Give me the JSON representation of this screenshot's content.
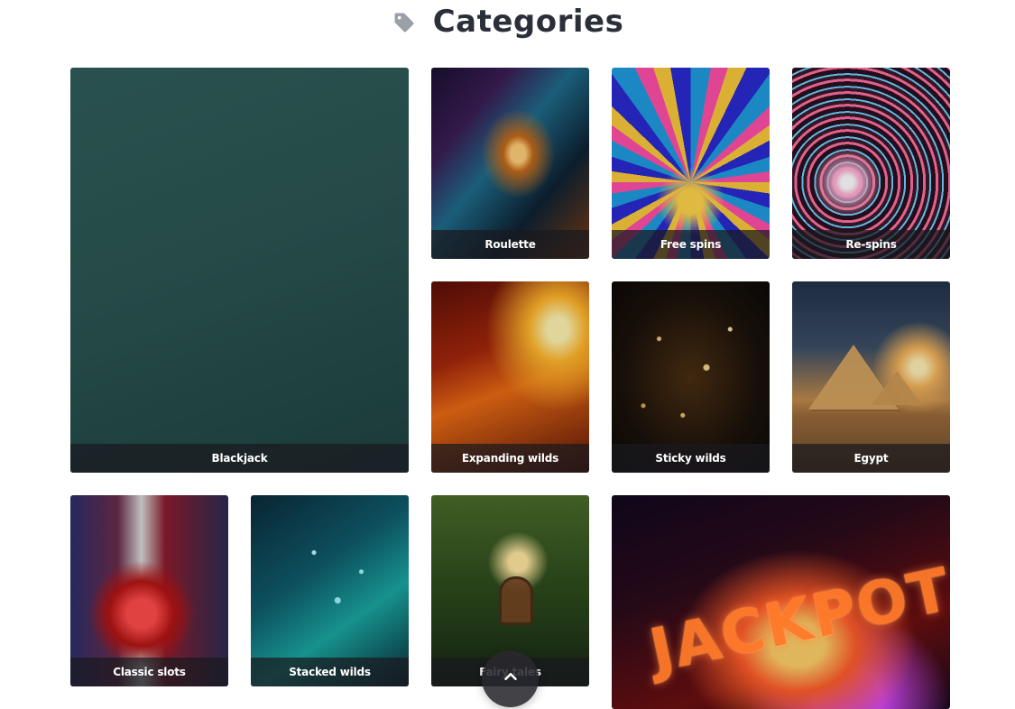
{
  "header": {
    "title": "Categories",
    "icon": "tag-icon"
  },
  "tiles": [
    {
      "label": "Blackjack",
      "icon": "blackjack-image"
    },
    {
      "label": "Roulette",
      "icon": "roulette-image"
    },
    {
      "label": "Free spins",
      "icon": "free-spins-image"
    },
    {
      "label": "Re-spins",
      "icon": "re-spins-image"
    },
    {
      "label": "Expanding wilds",
      "icon": "expanding-wilds-image"
    },
    {
      "label": "Sticky wilds",
      "icon": "sticky-wilds-image"
    },
    {
      "label": "Egypt",
      "icon": "egypt-image"
    },
    {
      "label": "Classic slots",
      "icon": "classic-slots-image"
    },
    {
      "label": "Stacked wilds",
      "icon": "stacked-wilds-image"
    },
    {
      "label": "Fairy tales",
      "icon": "fairy-tales-image"
    },
    {
      "label": "",
      "icon": "jackpot-image"
    }
  ],
  "jackpot_tile": {
    "art_text": "JACKPOT"
  },
  "scroll_to_top": {
    "icon": "chevron-up-icon"
  },
  "colors": {
    "title": "#2a2f3a",
    "caption_bg": "rgba(25,25,30,0.72)",
    "caption_text": "#ffffff",
    "tag_icon": "#9aa0a8"
  }
}
